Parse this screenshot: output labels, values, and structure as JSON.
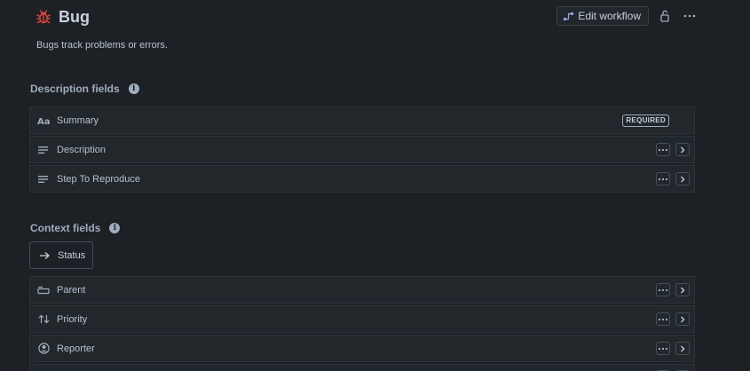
{
  "header": {
    "title": "Bug",
    "icon": "bug-icon",
    "accent_color": "#e2483d"
  },
  "subtitle": "Bugs track problems or errors.",
  "actions": {
    "edit_workflow_label": "Edit workflow",
    "lock_icon": "unlock-icon",
    "more_icon": "more-icon"
  },
  "description_section": {
    "heading": "Description fields",
    "fields": [
      {
        "label": "Summary",
        "icon": "text-format-icon",
        "badge": "REQUIRED"
      },
      {
        "label": "Description",
        "icon": "paragraph-icon"
      },
      {
        "label": "Step To Reproduce",
        "icon": "paragraph-icon"
      }
    ]
  },
  "context_section": {
    "heading": "Context fields",
    "status_label": "Status",
    "fields": [
      {
        "label": "Parent",
        "icon": "parent-icon"
      },
      {
        "label": "Priority",
        "icon": "priority-icon"
      },
      {
        "label": "Reporter",
        "icon": "person-icon"
      }
    ]
  }
}
